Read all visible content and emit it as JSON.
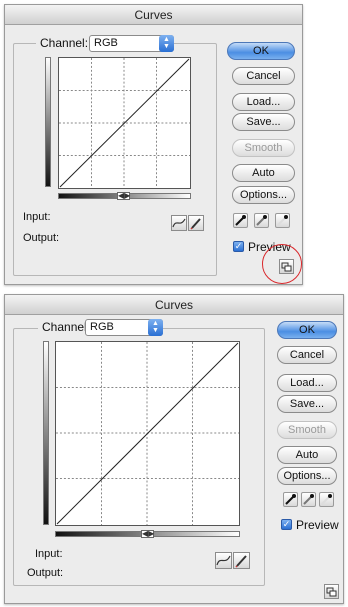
{
  "dialog": {
    "title": "Curves",
    "channel_label": "Channel:",
    "channel_value": "RGB",
    "buttons": {
      "ok": "OK",
      "cancel": "Cancel",
      "load": "Load...",
      "save": "Save...",
      "smooth": "Smooth",
      "auto": "Auto",
      "options": "Options..."
    },
    "input_label": "Input:",
    "output_label": "Output:",
    "preview_label": "Preview",
    "preview_checked": true,
    "slider_glyph": "◀▶",
    "check_glyph": "✓"
  },
  "annotation": {
    "highlight_color": "#d9262a",
    "target": "expand-view-icon"
  },
  "icons": [
    "curve-tool-icon",
    "pencil-icon",
    "black-eyedropper-icon",
    "gray-eyedropper-icon",
    "white-eyedropper-icon",
    "expand-view-icon",
    "chevron-updown-icon",
    "checkmark-icon"
  ]
}
